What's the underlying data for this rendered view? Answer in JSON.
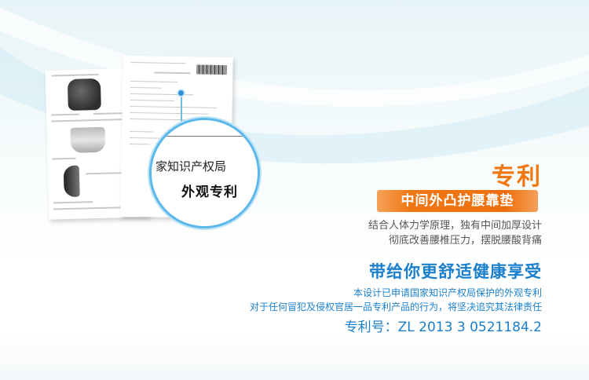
{
  "documents": {
    "magnifier_text_office": "家知识产权局",
    "magnifier_text_design": "外观专利"
  },
  "product": {
    "title": "专利",
    "banner": "中间外凸护腰靠垫",
    "description_line1": "结合人体力学原理，独有中间加厚设计",
    "description_line2": "彻底改善腰椎压力，摆脱腰酸背痛"
  },
  "slogan": "带给你更舒适健康享受",
  "notice": {
    "line1": "本设计已申请国家知识产权局保护的外观专利",
    "line2": "对于任何冒犯及侵权官居一品专利产品的行为，将坚决追究其法律责任"
  },
  "patent_number": "专利号：ZL  2013 3 0521184.2",
  "colors": {
    "accent_orange": "#f07813",
    "accent_blue": "#1a7fcc",
    "circle_blue": "#5bb8ea"
  },
  "icons": [
    "cushion-image",
    "magnifier-circle",
    "callout-dot"
  ]
}
